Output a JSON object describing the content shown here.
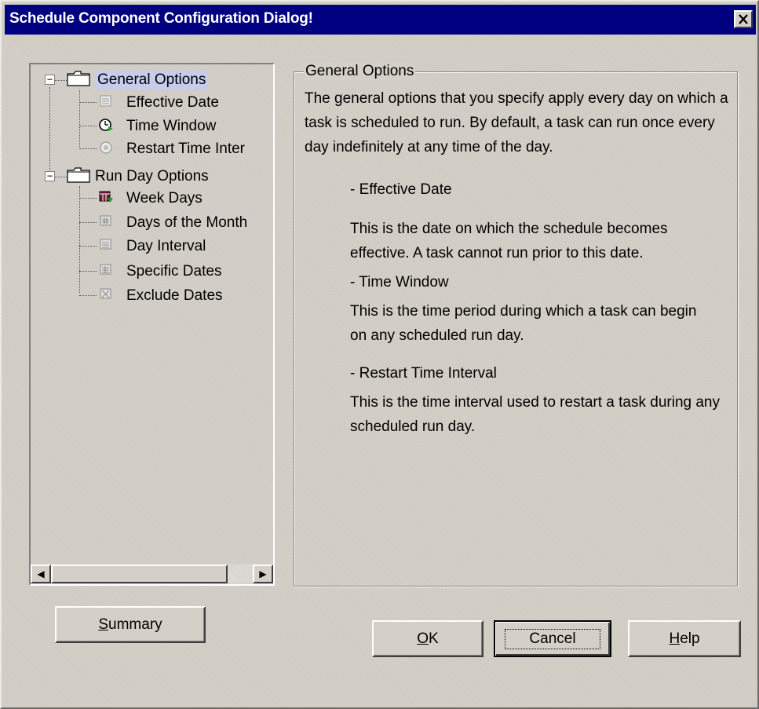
{
  "window": {
    "title": "Schedule Component Configuration Dialog!",
    "close_glyph": "✕"
  },
  "tree": {
    "groups": [
      {
        "label": "General Options",
        "expander": "−",
        "selected": true,
        "icon": "folder-icon",
        "children": [
          {
            "label": "Effective Date",
            "icon": "calendar-date-icon"
          },
          {
            "label": "Time Window",
            "icon": "clock-icon"
          },
          {
            "label": "Restart Time Inter",
            "icon": "restart-timer-icon"
          }
        ]
      },
      {
        "label": "Run Day Options",
        "expander": "−",
        "selected": false,
        "icon": "folder-icon",
        "children": [
          {
            "label": "Week Days",
            "icon": "week-calendar-icon"
          },
          {
            "label": "Days of the Month",
            "icon": "month-calendar-icon"
          },
          {
            "label": "Day Interval",
            "icon": "interval-calendar-icon"
          },
          {
            "label": "Specific Dates",
            "icon": "specific-dates-icon"
          },
          {
            "label": "Exclude Dates",
            "icon": "exclude-dates-icon"
          }
        ]
      }
    ],
    "scroll_left_glyph": "◀",
    "scroll_right_glyph": "▶"
  },
  "panel": {
    "legend": "General Options",
    "intro": "The general options that you specify apply every day on which a task is scheduled to run. By default, a task can run once every day indefinitely at any time of the day.",
    "sections": [
      {
        "heading": "- Effective Date",
        "text": "This is the date on which the schedule becomes effective. A task cannot run prior to this date."
      },
      {
        "heading": "- Time Window",
        "text": "This is the time period during which a task can begin on any scheduled run day."
      },
      {
        "heading": "- Restart Time Interval",
        "text": "This is the time interval used to restart a task during any scheduled run day."
      }
    ]
  },
  "buttons": {
    "summary": {
      "mnemonic": "S",
      "rest": "ummary"
    },
    "ok": {
      "mnemonic": "O",
      "rest": "K"
    },
    "cancel": {
      "mnemonic": "",
      "rest": "Cancel"
    },
    "help": {
      "mnemonic": "H",
      "rest": "elp"
    }
  },
  "colors": {
    "titlebar": "#000080",
    "face": "#d4d0c8",
    "selection": "#c8ccec"
  }
}
